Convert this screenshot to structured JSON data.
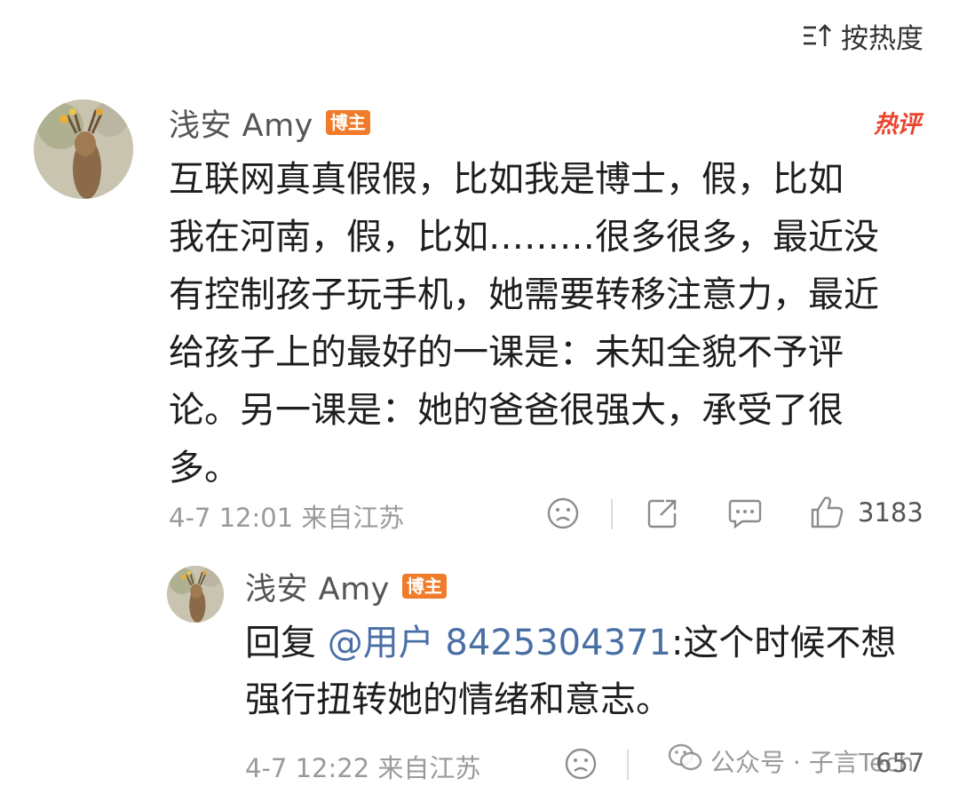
{
  "sort": {
    "label": "按热度",
    "icon": "sort-icon"
  },
  "comment": {
    "username": "浅安 Amy",
    "badge": "博主",
    "hot_tag": "热评",
    "lines": [
      "互联网真真假假，比如我是博士，假，比如",
      "我在河南，假，比如………很多很多，最近没",
      "有控制孩子玩手机，她需要转移注意力，最近",
      "给孩子上的最好的一课是：未知全貌不予评",
      "论。另一课是：她的爸爸很强大，承受了很",
      "多。"
    ],
    "timestamp": "4-7 12:01 来自江苏",
    "like_count": "3183",
    "icons": [
      "sad-face-icon",
      "share-icon",
      "comment-icon",
      "thumbs-up-icon"
    ]
  },
  "reply": {
    "username": "浅安 Amy",
    "badge": "博主",
    "prefix": "回复 ",
    "mention": "@用户 8425304371",
    "line1_rest": ":这个时候不想",
    "line2": "强行扭转她的情绪和意志。",
    "timestamp": "4-7 12:22 来自江苏",
    "like_count": "657"
  },
  "watermark": {
    "text": "公众号 · 子言Tech",
    "icon": "wechat-icon"
  },
  "colors": {
    "badge": "#f07b2a",
    "hot_tag": "#e8452f",
    "mention": "#4a6fa5",
    "meta": "#9a9a9a"
  }
}
